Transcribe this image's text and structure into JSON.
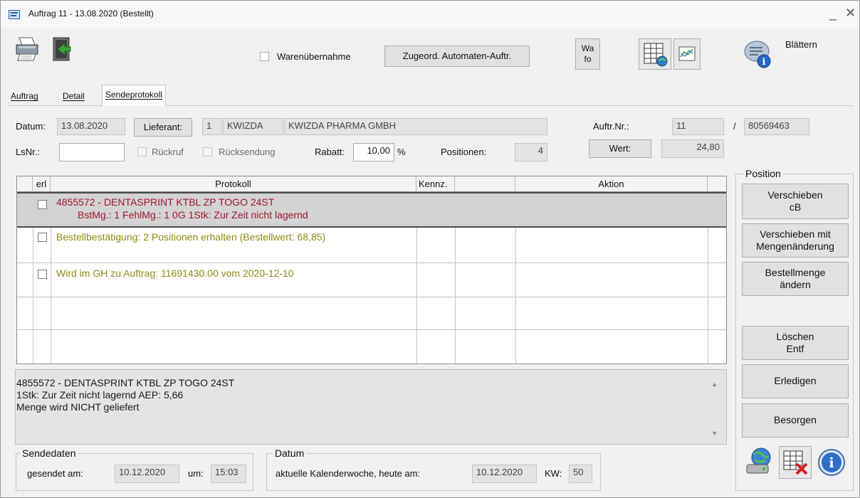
{
  "window": {
    "title": "Auftrag 11 - 13.08.2020 (Bestellt)",
    "minimize": "_",
    "close": "✕"
  },
  "toolbar": {
    "printer_icon": "printer-icon",
    "exit_icon": "exit-door-icon",
    "warenuebernahme_label": "Warenübernahme",
    "automaten_button": "Zugeord. Automaten-Auftr.",
    "wafo_line1": "Wa",
    "wafo_line2": "fo",
    "blaettern_label": "Blättern"
  },
  "tabs": [
    "Auftrag",
    "Detail",
    "Sendeprotokoll"
  ],
  "header": {
    "datum_label": "Datum:",
    "datum_value": "13.08.2020",
    "lieferant_button": "Lieferant:",
    "lieferant_nr": "1",
    "lieferant_code": "KWIZDA",
    "lieferant_name": "KWIZDA PHARMA GMBH",
    "auftr_label": "Auftr.Nr.:",
    "auftr_value": "11",
    "slash": "/",
    "auftr_ext": "80569463",
    "lsnr_label": "LsNr.:",
    "lsnr_value": "",
    "rueckruf_label": "Rückruf",
    "ruecksendung_label": "Rücksendung",
    "rabatt_label": "Rabatt:",
    "rabatt_value": "10,00",
    "rabatt_unit": "%",
    "positionen_label": "Positionen:",
    "positionen_value": "4",
    "wert_button": "Wert:",
    "wert_value": "24,80"
  },
  "grid": {
    "columns": [
      "erl",
      "Protokoll",
      "Kennz.",
      "",
      "Aktion"
    ],
    "rows": [
      {
        "line1": "4855572 - DENTASPRINT KTBL ZP TOGO 24ST",
        "line2": "BstMg.: 1  FehlMg.: 1  0G  1Stk: Zur Zeit nicht lagernd",
        "color": "#a3142a"
      },
      {
        "line1": "Bestellbestätigung: 2 Positionen erhalten (Bestellwert: 68,85)",
        "color": "#8c8c12"
      },
      {
        "line1": "Wird im GH zu Auftrag: 11691430.00 vom 2020-12-10",
        "color": "#8c8c12"
      }
    ]
  },
  "info": {
    "line1": "4855572 - DENTASPRINT KTBL ZP TOGO 24ST",
    "line2": "1Stk: Zur Zeit nicht lagernd AEP: 5,66",
    "line3": "Menge wird NICHT geliefert"
  },
  "position_panel": {
    "title": "Position",
    "verschieben_cb_1": "Verschieben",
    "verschieben_cb_2": "cB",
    "verschieben_mit_1": "Verschieben mit",
    "verschieben_mit_2": "Mengenänderung",
    "bestellmenge_1": "Bestellmenge",
    "bestellmenge_2": "ändern",
    "loeschen_1": "Löschen",
    "loeschen_2": "Entf",
    "erledigen": "Erledigen",
    "besorgen": "Besorgen"
  },
  "sendedaten": {
    "title": "Sendedaten",
    "gesendet_label": "gesendet am:",
    "gesendet_value": "10.12.2020",
    "um_label": "um:",
    "um_value": "15:03"
  },
  "datum_box": {
    "title": "Datum",
    "kw_text_label": "aktuelle Kalenderwoche, heute am:",
    "heute_value": "10.12.2020",
    "kw_label": "KW:",
    "kw_value": "50"
  }
}
